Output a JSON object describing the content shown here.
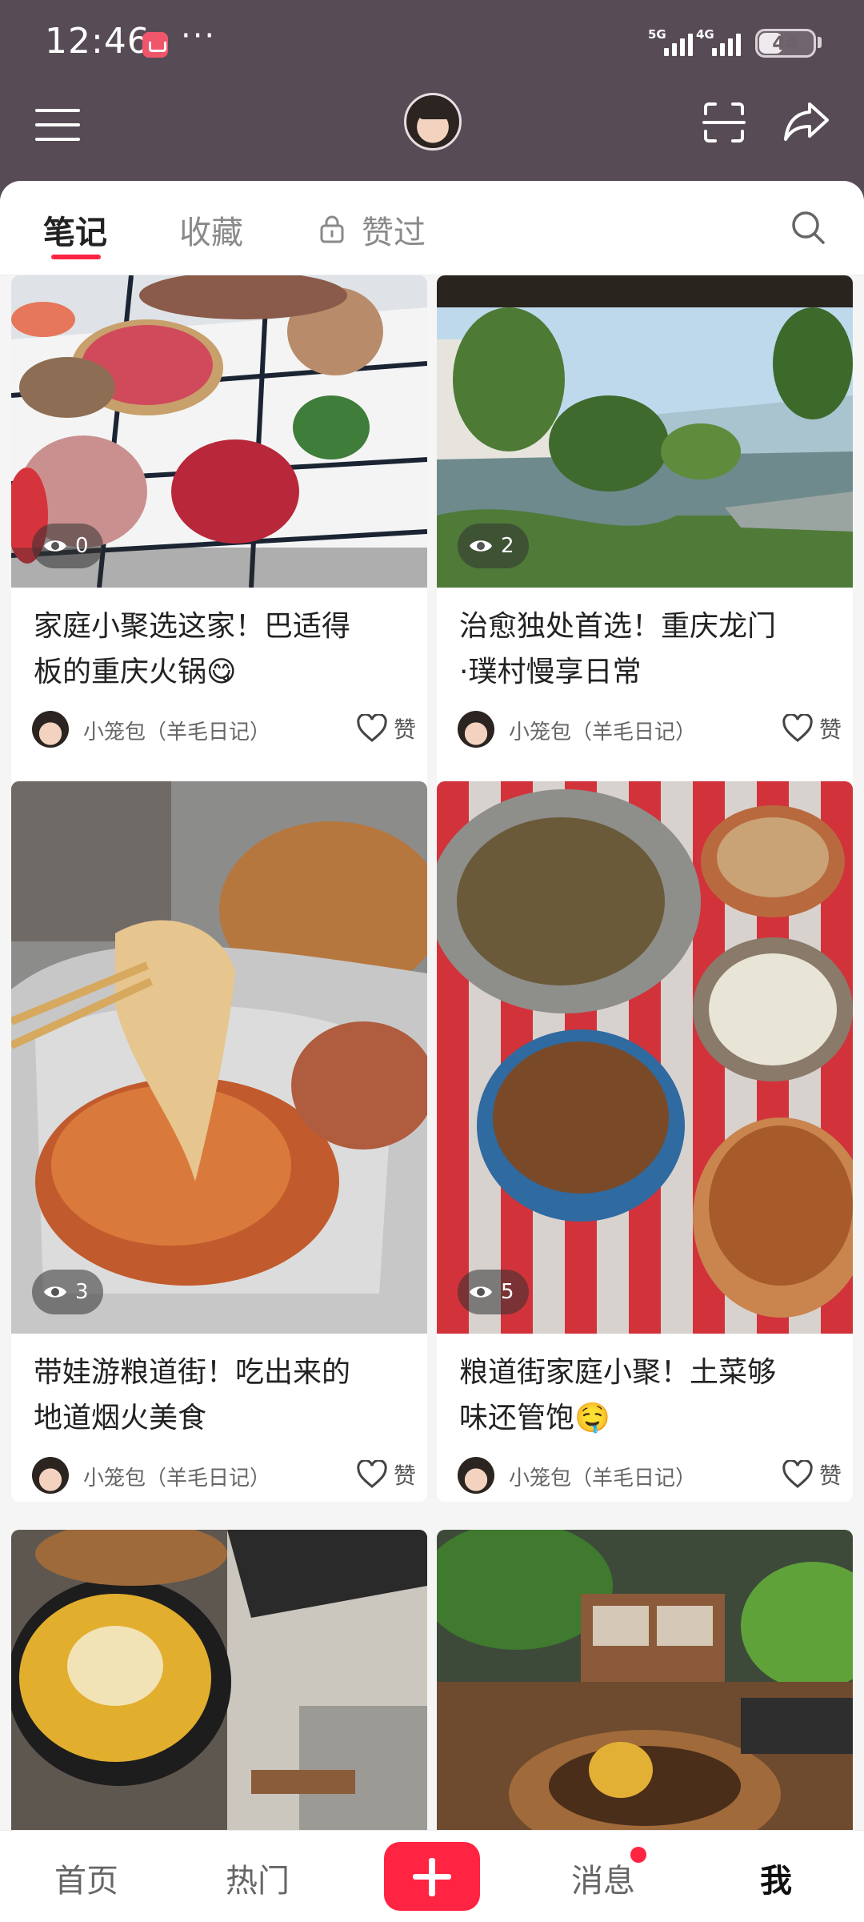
{
  "status_bar": {
    "time": "12:46",
    "more": "···",
    "signal_1_label": "5G",
    "signal_2_label": "4G",
    "battery": "44",
    "battery_level": 0.44
  },
  "header": {
    "menu_icon": "hamburger-menu-icon",
    "scan_icon": "scan-icon",
    "share_icon": "share-icon"
  },
  "tabs": {
    "notes": "笔记",
    "collections": "收藏",
    "liked": "赞过"
  },
  "cards": [
    {
      "title_line1": "家庭小聚选这家！巴适得",
      "title_line2": "板的重庆火锅😋",
      "views": "0",
      "author": "小笼包（羊毛日记）",
      "like": "赞"
    },
    {
      "title_line1": "治愈独处首选！重庆龙门",
      "title_line2": "·璞村慢享日常",
      "views": "2",
      "author": "小笼包（羊毛日记）",
      "like": "赞"
    },
    {
      "title_line1": "带娃游粮道街！吃出来的",
      "title_line2": "地道烟火美食",
      "views": "3",
      "author": "小笼包（羊毛日记）",
      "like": "赞"
    },
    {
      "title_line1": "粮道街家庭小聚！土菜够",
      "title_line2": "味还管饱🤤",
      "views": "5",
      "author": "小笼包（羊毛日记）",
      "like": "赞"
    }
  ],
  "bottom_nav": {
    "home": "首页",
    "hot": "热门",
    "messages": "消息",
    "me": "我"
  },
  "colors": {
    "accent": "#ff2442",
    "header_bg": "#574b55"
  }
}
